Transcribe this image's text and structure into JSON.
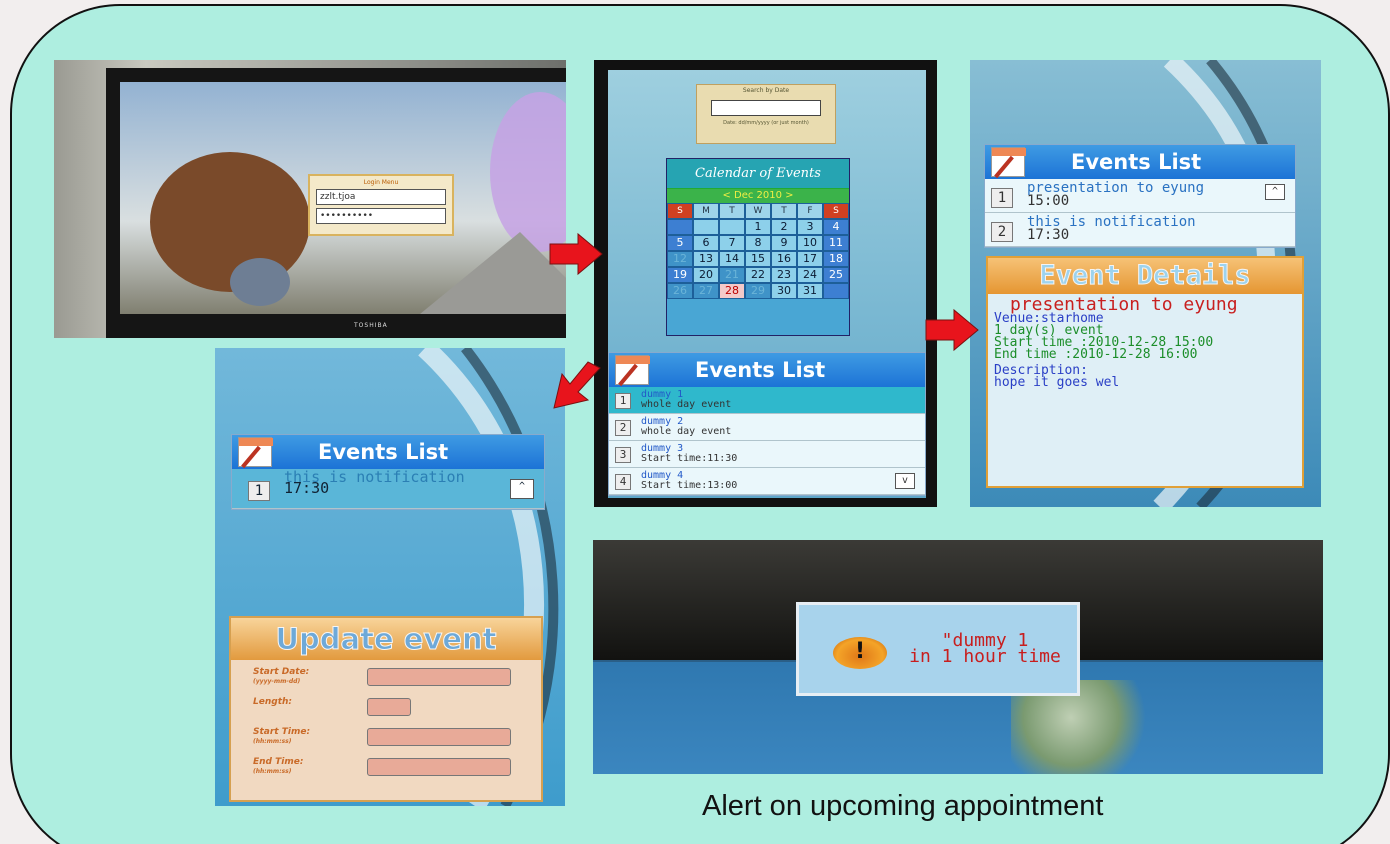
{
  "tv_login": {
    "title": "Login Menu",
    "username": "zzlt.tjoa",
    "password": "••••••••••",
    "brand": "TOSHIBA"
  },
  "search_box": {
    "title": "Search by Date",
    "hint": "Date: dd/mm/yyyy (or just month)"
  },
  "calendar": {
    "title": "Calendar of Events",
    "month": "< Dec 2010 >",
    "weekdays": [
      "S",
      "M",
      "T",
      "W",
      "T",
      "F",
      "S"
    ],
    "weeks": [
      [
        "",
        "",
        "",
        "1",
        "2",
        "3",
        "4"
      ],
      [
        "5",
        "6",
        "7",
        "8",
        "9",
        "10",
        "11"
      ],
      [
        "12",
        "13",
        "14",
        "15",
        "16",
        "17",
        "18"
      ],
      [
        "19",
        "20",
        "21",
        "22",
        "23",
        "24",
        "25"
      ],
      [
        "26",
        "27",
        "28",
        "29",
        "30",
        "31",
        ""
      ]
    ]
  },
  "mid_events": {
    "title": "Events List",
    "items": [
      {
        "num": "1",
        "line1": "dummy 1",
        "line2": "whole day event"
      },
      {
        "num": "2",
        "line1": "dummy 2",
        "line2": "whole day event"
      },
      {
        "num": "3",
        "line1": "dummy 3",
        "line2": "Start time:11:30"
      },
      {
        "num": "4",
        "line1": "dummy 4",
        "line2": "Start time:13:00"
      }
    ],
    "down_label": "v"
  },
  "right_events": {
    "title": "Events List",
    "items": [
      {
        "num": "1",
        "line1": "presentation to eyung",
        "line2": "15:00"
      },
      {
        "num": "2",
        "line1": "this is notification",
        "line2": "17:30"
      }
    ],
    "up_label": "^"
  },
  "event_details": {
    "header": "Event Details",
    "title": "presentation to eyung",
    "venue": "Venue:starhome",
    "duration": "1 day(s) event",
    "start": "Start time :2010-12-28 15:00",
    "end": "End time   :2010-12-28 16:00",
    "desc_label": "Description:",
    "desc": "hope it goes wel"
  },
  "bl_events": {
    "title": "Events List",
    "items": [
      {
        "num": "1",
        "line1": "this is notification",
        "line2": "17:30"
      }
    ],
    "up_label": "^"
  },
  "update_event": {
    "header": "Update event",
    "fields": [
      {
        "label": "Start Date:",
        "sub": "(yyyy-mm-dd)"
      },
      {
        "label": "Length:",
        "sub": ""
      },
      {
        "label": "Start Time:",
        "sub": "(hh:mm:ss)"
      },
      {
        "label": "End Time:",
        "sub": "(hh:mm:ss)"
      }
    ]
  },
  "alert": {
    "line1": "\"dummy 1",
    "line2": "in 1 hour time",
    "icon": "!"
  },
  "caption": "Alert on upcoming appointment",
  "colors": {
    "frame": "#aeeee0",
    "arrow": "#e8141c",
    "header_blue": "#1c73d6",
    "alert_text": "#c81e1e"
  }
}
